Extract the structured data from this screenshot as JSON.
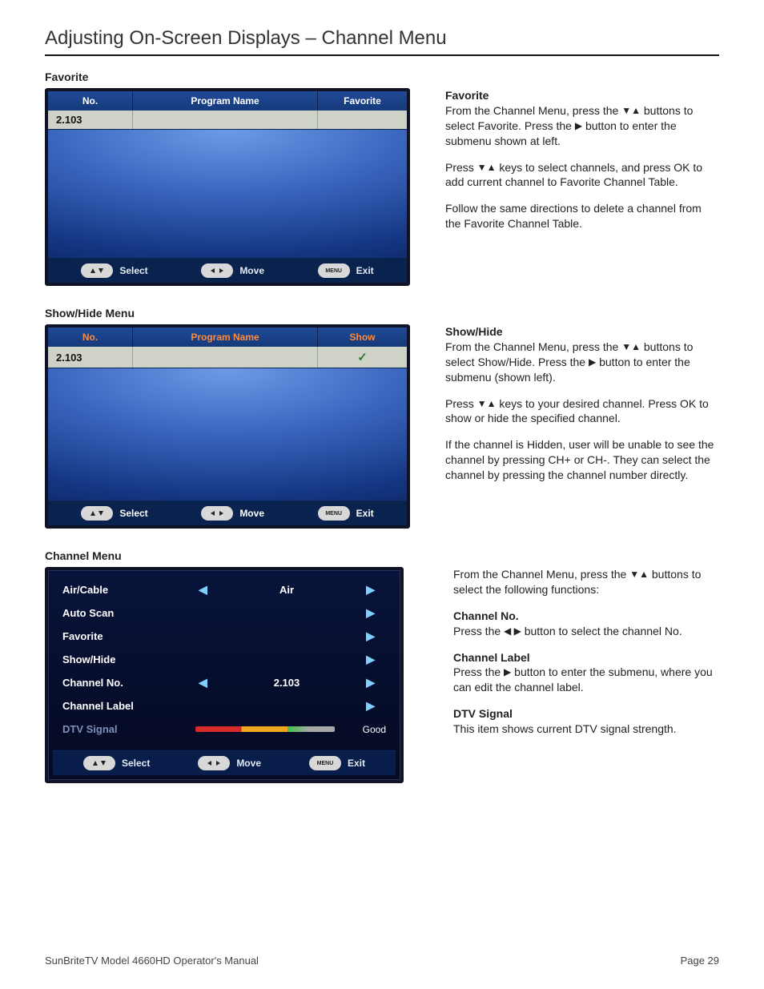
{
  "page": {
    "title": "Adjusting On-Screen Displays – Channel Menu",
    "footer_left": "SunBriteTV Model 4660HD Operator's Manual",
    "footer_right": "Page 29"
  },
  "glyphs": {
    "down_up": "▼▲",
    "right": "▶",
    "left_right": "◀ ▶",
    "check": "✓",
    "arrow_l": "◀",
    "arrow_r": "▶"
  },
  "favorite": {
    "heading": "Favorite",
    "table": {
      "headers": [
        "No.",
        "Program Name",
        "Favorite"
      ],
      "row_no": "2.103",
      "row_name": "",
      "row_flag": ""
    },
    "desc": {
      "title": "Favorite",
      "p1a": "From the Channel Menu, press the ",
      "p1b": " buttons to select Favorite. Press the ",
      "p1c": " button to enter the submenu shown at left.",
      "p2a": "Press ",
      "p2b": " keys to select channels, and press  OK to add current channel to Favorite Channel Table.",
      "p3": "Follow the same directions to delete a channel from the Favorite Channel Table."
    }
  },
  "showhide": {
    "heading": "Show/Hide Menu",
    "table": {
      "headers": [
        "No.",
        "Program Name",
        "Show"
      ],
      "row_no": "2.103",
      "row_name": "",
      "row_flag": "check"
    },
    "desc": {
      "title": "Show/Hide",
      "p1a": "From the Channel Menu, press the ",
      "p1b": " buttons to select Show/Hide. Press the ",
      "p1c": " button to enter the submenu (shown left).",
      "p2a": "Press ",
      "p2b": " keys to your desired channel. Press OK to show or hide the specified channel.",
      "p3": "If the channel is Hidden, user will be unable to see the channel by pressing CH+ or CH-. They can select the channel by pressing the channel number directly."
    }
  },
  "channel_menu": {
    "heading": "Channel Menu",
    "items": [
      {
        "label": "Air/Cable",
        "value": "Air",
        "left": true,
        "right": true
      },
      {
        "label": "Auto Scan",
        "value": "",
        "left": false,
        "right": true
      },
      {
        "label": "Favorite",
        "value": "",
        "left": false,
        "right": true
      },
      {
        "label": "Show/Hide",
        "value": "",
        "left": false,
        "right": true
      },
      {
        "label": "Channel No.",
        "value": "2.103",
        "left": true,
        "right": true
      },
      {
        "label": "Channel Label",
        "value": "",
        "left": false,
        "right": true
      }
    ],
    "dtv": {
      "label": "DTV Signal",
      "status": "Good"
    },
    "desc": {
      "p1a": "From the Channel Menu, press the ",
      "p1b": " buttons to select the following functions:",
      "cn_title": "Channel No.",
      "cn_a": "Press the ",
      "cn_b": " button to select the channel No.",
      "cl_title": "Channel Label",
      "cl_a": "Press the ",
      "cl_b": " button to enter the submenu, where you can edit the channel label.",
      "dtv_title": "DTV Signal",
      "dtv_text": "This item shows current DTV signal strength."
    }
  },
  "footbar": {
    "select": "Select",
    "move": "Move",
    "exit": "Exit",
    "menu_key": "MENU"
  }
}
